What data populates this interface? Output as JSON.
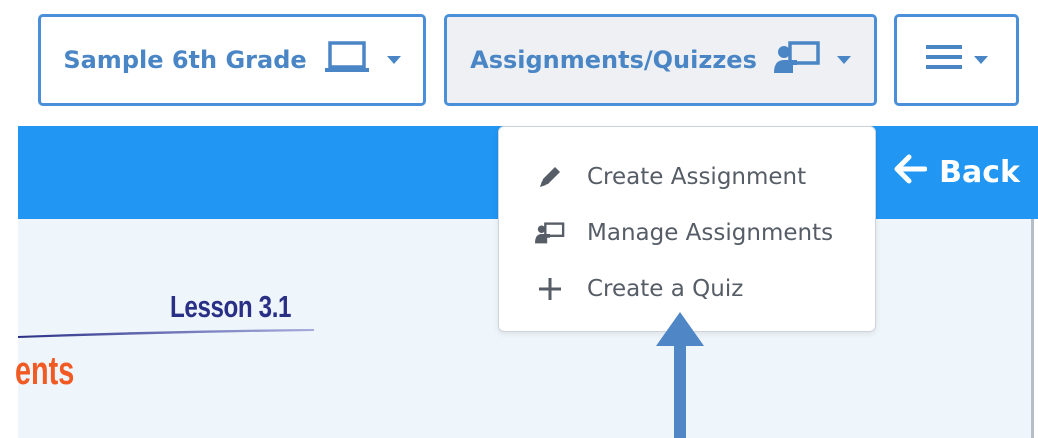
{
  "toolbar": {
    "class_selector": {
      "label": "Sample 6th Grade",
      "icon": "laptop-icon"
    },
    "assignments_selector": {
      "label": "Assignments/Quizzes",
      "icon": "teacher-board-icon"
    },
    "menu_button": {
      "icon": "hamburger-icon"
    }
  },
  "header": {
    "back_label": "Back",
    "back_icon": "arrow-left-icon"
  },
  "dropdown": {
    "items": [
      {
        "label": "Create Assignment",
        "icon": "pencil-icon"
      },
      {
        "label": "Manage Assignments",
        "icon": "teacher-board-icon"
      },
      {
        "label": "Create a Quiz",
        "icon": "plus-icon"
      }
    ]
  },
  "content": {
    "lesson_title": "Lesson 3.1",
    "orange_fragment": "ents"
  },
  "colors": {
    "accent_blue": "#2196f3",
    "button_border": "#4a90d9",
    "button_text": "#4a86c5",
    "lesson_title": "#2a2f86",
    "orange_text": "#f15a22",
    "annotation_arrow": "#4f86c6"
  }
}
